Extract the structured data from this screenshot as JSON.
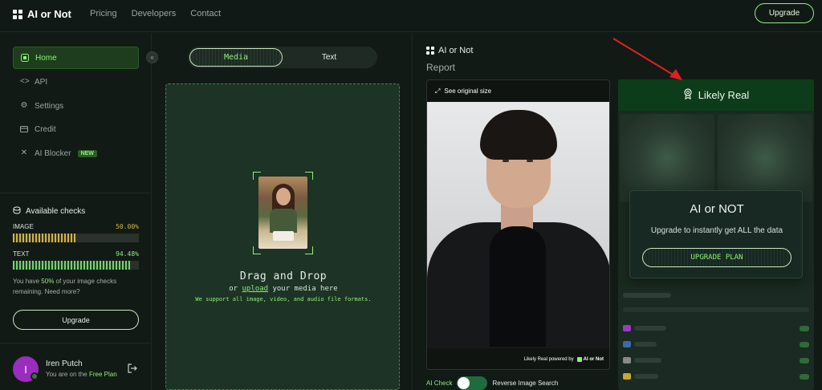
{
  "nav": {
    "brand": "AI or Not",
    "links": [
      "Pricing",
      "Developers",
      "Contact"
    ],
    "upgrade_label": "Upgrade"
  },
  "sidebar": {
    "items": [
      {
        "label": "Home",
        "icon": "home-icon",
        "active": true
      },
      {
        "label": "API",
        "icon": "code-icon"
      },
      {
        "label": "Settings",
        "icon": "gear-icon"
      },
      {
        "label": "Credit",
        "icon": "card-icon"
      },
      {
        "label": "AI Blocker",
        "icon": "close-icon",
        "badge": "NEW"
      }
    ],
    "checks": {
      "title": "Available checks",
      "image_label": "IMAGE",
      "image_pct": "50.00%",
      "image_fill": 0.5,
      "text_label": "TEXT",
      "text_pct": "94.48%",
      "text_fill": 0.9448,
      "remain_prefix": "You have ",
      "remain_pct": "50%",
      "remain_suffix": " of your image checks remaining. Need more?",
      "upgrade_label": "Upgrade"
    },
    "user": {
      "initial": "I",
      "name": "Iren Putch",
      "plan_prefix": "You are on the ",
      "plan_name": "Free Plan"
    }
  },
  "upload": {
    "tabs": [
      "Media",
      "Text"
    ],
    "active_tab": "Media",
    "title": "Drag and Drop",
    "sub_prefix": "or ",
    "sub_link": "upload",
    "sub_suffix": " your media here",
    "note": "We support all image, video, and audio file formats."
  },
  "report": {
    "brand": "AI or Not",
    "title": "Report",
    "original_size_label": "See original size",
    "footer_prefix": "Likely Real powered by",
    "footer_brand": "AI or Not",
    "toggle_left": "AI Check",
    "toggle_right": "Reverse Image Search",
    "result": "Likely Real",
    "modal_title": "AI or NOT",
    "modal_sub": "Upgrade to instantly get ALL the data",
    "modal_button": "UPGRADE PLAN"
  },
  "colors": {
    "accent": "#8ff07a",
    "image_bar": "#d6b23e",
    "text_bar": "#6fd66a",
    "result_header": "#0d3c1a",
    "annotation_arrow": "#e02020"
  }
}
